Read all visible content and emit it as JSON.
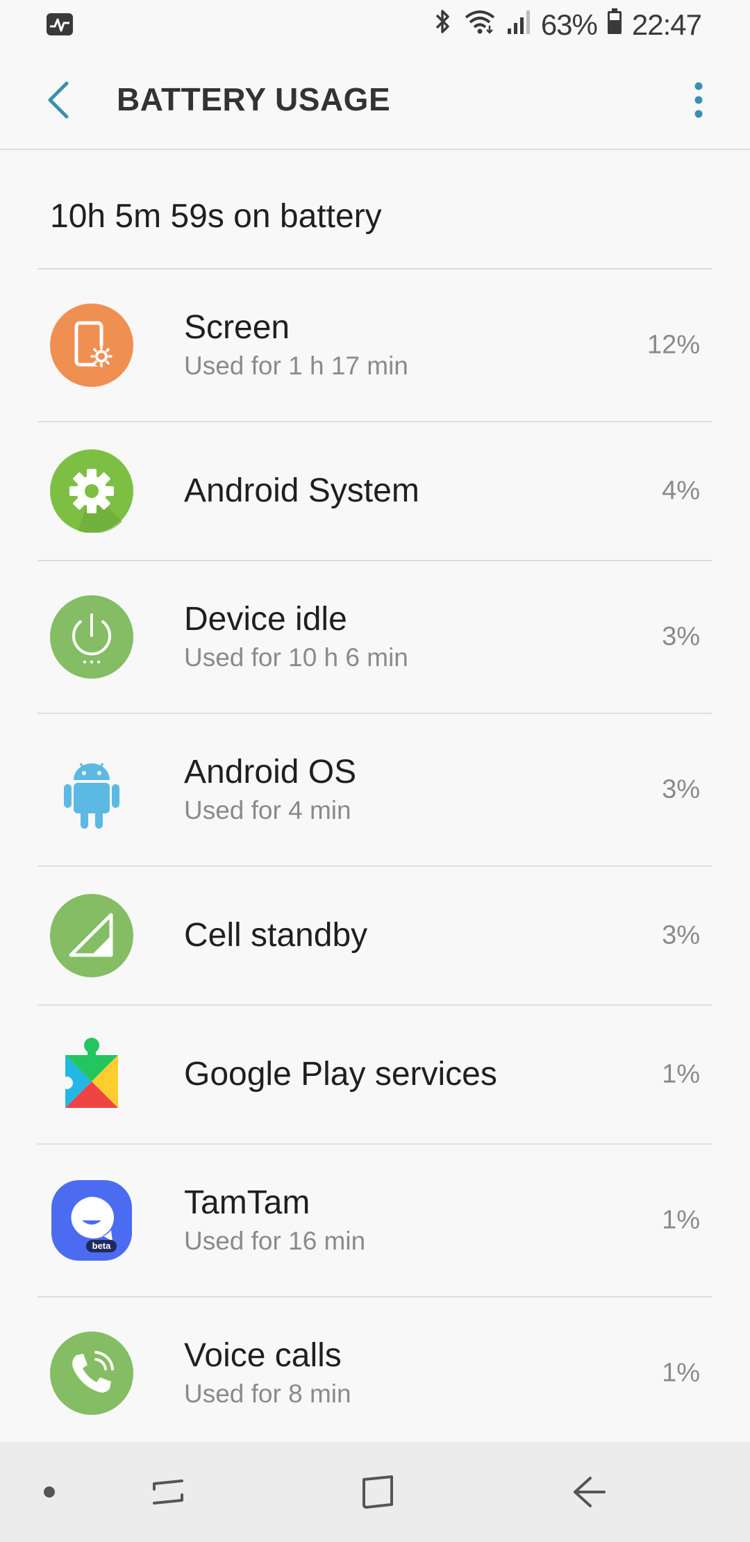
{
  "status_bar": {
    "battery_percent": "63%",
    "time": "22:47",
    "icons": [
      "pulse-icon",
      "bluetooth-icon",
      "wifi-icon",
      "signal-icon",
      "battery-icon"
    ]
  },
  "app_bar": {
    "title": "BATTERY USAGE",
    "back_icon": "back-arrow-icon",
    "more_icon": "more-vert-icon",
    "accent_color": "#3c8fb0"
  },
  "summary": {
    "text": "10h 5m 59s on battery"
  },
  "items": [
    {
      "name": "Screen",
      "sub": "Used for 1 h 17 min",
      "percent": "12%",
      "icon": "screen-brightness-icon",
      "color": "#ef8f52"
    },
    {
      "name": "Android System",
      "sub": "",
      "percent": "4%",
      "icon": "gear-icon",
      "color": "#7dbf43"
    },
    {
      "name": "Device idle",
      "sub": "Used for 10 h 6 min",
      "percent": "3%",
      "icon": "power-icon",
      "color": "#84bd64"
    },
    {
      "name": "Android OS",
      "sub": "Used for 4 min",
      "percent": "3%",
      "icon": "android-robot-icon",
      "color": "#5bb9e4"
    },
    {
      "name": "Cell standby",
      "sub": "",
      "percent": "3%",
      "icon": "cell-signal-icon",
      "color": "#84bd64"
    },
    {
      "name": "Google Play services",
      "sub": "",
      "percent": "1%",
      "icon": "google-play-services-icon",
      "color": "#ffffff"
    },
    {
      "name": "TamTam",
      "sub": "Used for 16 min",
      "percent": "1%",
      "icon": "tamtam-icon",
      "color": "#4b6cf0",
      "badge": "beta"
    },
    {
      "name": "Voice calls",
      "sub": "Used for 8 min",
      "percent": "1%",
      "icon": "phone-icon",
      "color": "#84bd64"
    }
  ],
  "nav_bar": {
    "icons": [
      "dot-icon",
      "recents-icon",
      "home-icon",
      "back-icon"
    ]
  }
}
